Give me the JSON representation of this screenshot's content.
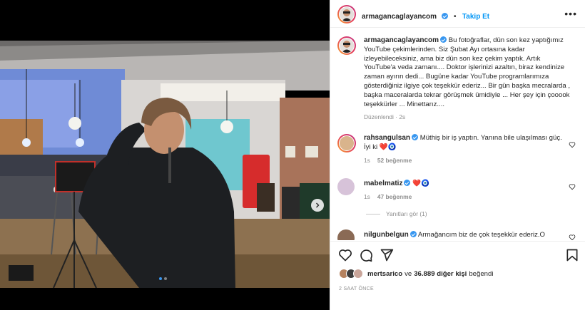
{
  "colors": {
    "accent": "#0095f6",
    "verified": "#3897f0",
    "like_red": "#ed4956"
  },
  "header": {
    "username": "armagancaglayancom",
    "separator": "•",
    "follow_label": "Takip Et",
    "more_label": "•••",
    "more_icon": "more-icon"
  },
  "caption": {
    "username": "armagancaglayancom",
    "text": "Bu fotoğraflar, dün son kez yaptığımız YouTube çekimlerinden. Siz Şubat Ayı ortasına kadar izleyebileceksiniz, ama biz dün son kez çekim yaptık. Artık YouTube'a veda zamanı.... Doktor işlerinizi azaltın, biraz kendinize zaman ayırın dedi... Bugüne kadar YouTube programlarımıza gösterdiğiniz ilgiye çok teşekkür ederiz... Bir gün başka mecralarda , başka maceralarda tekrar görüşmek ümidiyle ... Her şey için çooook teşekkürler ... Minettarız....",
    "meta": "Düzenlendi · 2s"
  },
  "comments": [
    {
      "username": "rahsangulsan",
      "text": "Müthiş bir iş yaptın. Yanına bile ulaşılması güç. İyi ki",
      "emoji": "❤️🧿",
      "time": "1s",
      "likes": "52 beğenme"
    },
    {
      "username": "mabelmatiz",
      "text": "",
      "emoji": "❤️🧿",
      "time": "1s",
      "likes": "47 beğenme"
    },
    {
      "username": "nilgunbelgun",
      "text": "Armağancım biz de çok teşekkür ederiz.O",
      "emoji": "",
      "time": "",
      "likes": ""
    }
  ],
  "replies_label": "Yanıtları gör (1)",
  "likes": {
    "prefix_user": "mertsarico",
    "connector": "ve",
    "count": "36.889 diğer kişi",
    "suffix": "beğendi"
  },
  "time_ago": "2 SAAT ÖNCE",
  "carousel": {
    "count": 2,
    "active": 0
  }
}
